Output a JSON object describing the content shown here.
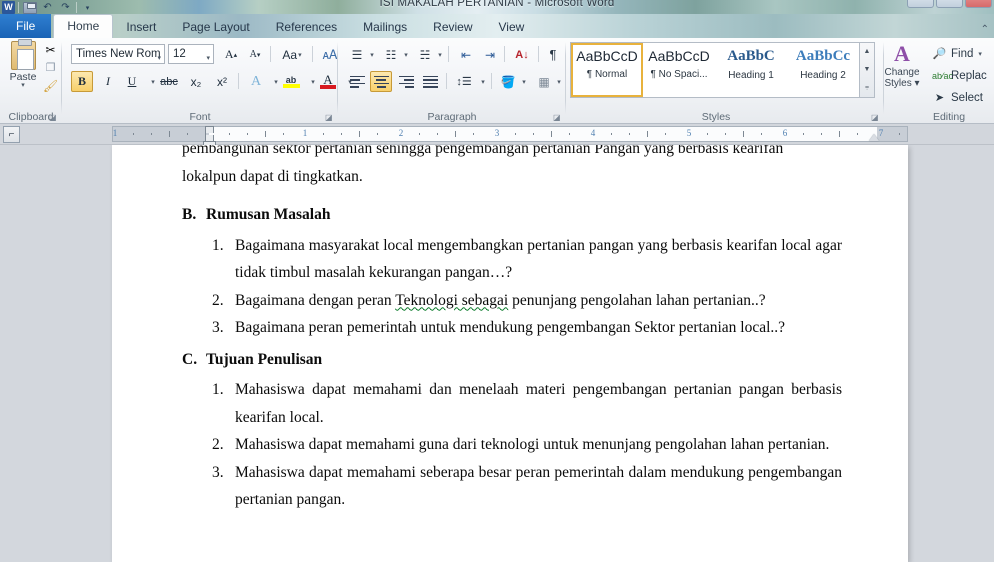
{
  "window": {
    "title": "ISI MAKALAH PERTANIAN - Microsoft Word",
    "app_icon": "word-icon",
    "quick_access": [
      "save-icon",
      "undo-icon",
      "redo-icon",
      "customize-qat-icon"
    ],
    "controls": [
      "minimize",
      "restore",
      "close"
    ],
    "ribbon_minimize_icon": "chevron-up-icon"
  },
  "tabs": [
    {
      "label": "File",
      "active": false,
      "type": "file"
    },
    {
      "label": "Home",
      "active": true
    },
    {
      "label": "Insert",
      "active": false
    },
    {
      "label": "Page Layout",
      "active": false
    },
    {
      "label": "References",
      "active": false
    },
    {
      "label": "Mailings",
      "active": false
    },
    {
      "label": "Review",
      "active": false
    },
    {
      "label": "View",
      "active": false
    }
  ],
  "ribbon": {
    "clipboard": {
      "label": "Clipboard",
      "paste_label": "Paste",
      "paste_icon": "clipboard-paste-icon",
      "paste_arrow": "▾",
      "cut_icon": "scissors-icon",
      "copy_icon": "copy-icon",
      "format_painter_icon": "paintbrush-icon",
      "launcher_icon": "dialog-launcher-icon"
    },
    "font": {
      "label": "Font",
      "font_name": "Times New Rom",
      "font_size": "12",
      "grow_font_icon": "grow-font-icon",
      "shrink_font_icon": "shrink-font-icon",
      "change_case_icon": "change-case-icon",
      "clear_formatting_icon": "clear-formatting-icon",
      "bold_label": "B",
      "italic_label": "I",
      "underline_label": "U",
      "strikethrough_label": "abc",
      "subscript_label": "x₂",
      "superscript_label": "x²",
      "text_effects_icon": "text-effects-icon",
      "highlight_icon": "text-highlight-icon",
      "font_color_icon": "font-color-icon",
      "launcher_icon": "dialog-launcher-icon",
      "bold_active": true
    },
    "paragraph": {
      "label": "Paragraph",
      "bullets_icon": "bullets-icon",
      "numbering_icon": "numbering-icon",
      "multilevel_icon": "multilevel-list-icon",
      "decrease_indent_icon": "decrease-indent-icon",
      "increase_indent_icon": "increase-indent-icon",
      "sort_icon": "sort-az-icon",
      "show_marks_icon": "pilcrow-icon",
      "align_left_icon": "align-left-icon",
      "align_center_icon": "align-center-icon",
      "align_right_icon": "align-right-icon",
      "justify_icon": "justify-icon",
      "line_spacing_icon": "line-spacing-icon",
      "shading_icon": "shading-icon",
      "borders_icon": "borders-icon",
      "launcher_icon": "dialog-launcher-icon",
      "align_center_active": true
    },
    "styles": {
      "label": "Styles",
      "gallery": [
        {
          "sample": "AaBbCcD",
          "name": "¶ Normal",
          "selected": true
        },
        {
          "sample": "AaBbCcD",
          "name": "¶ No Spaci...",
          "selected": false
        },
        {
          "sample": "AaBbC",
          "name": "Heading 1",
          "selected": false
        },
        {
          "sample": "AaBbCc",
          "name": "Heading 2",
          "selected": false
        }
      ],
      "scroll_up_icon": "scroll-up-icon",
      "scroll_down_icon": "scroll-down-icon",
      "more_icon": "more-styles-icon",
      "change_styles_label": "Change\nStyles",
      "change_styles_line1": "Change",
      "change_styles_line2": "Styles ▾",
      "change_styles_icon": "change-styles-icon",
      "launcher_icon": "dialog-launcher-icon"
    },
    "editing": {
      "label": "Editing",
      "find_label": "Find",
      "find_icon": "binoculars-icon",
      "find_chevron": "▾",
      "replace_label": "Replac",
      "replace_icon": "replace-icon",
      "select_label": "Select",
      "select_icon": "cursor-arrow-icon"
    }
  },
  "ruler": {
    "tab_selector_icon": "tab-left-icon",
    "numbers": [
      "1",
      "1",
      "2",
      "3",
      "4",
      "5",
      "6",
      "7"
    ],
    "left_indent_icon": "left-indent-marker",
    "right_indent_icon": "right-indent-marker"
  },
  "document": {
    "paragraphs": [
      {
        "type": "text",
        "clipped_top": true,
        "text": "pembangunan sektor pertanian sehingga pengembangan pertanian Pangan yang berbasis kearifan"
      },
      {
        "type": "text",
        "text": "lokalpun dapat di tingkatkan."
      }
    ],
    "sections": [
      {
        "label": "B.",
        "heading": "Rumusan Masalah",
        "items": [
          {
            "n": "1.",
            "text": "Bagaimana masyarakat local mengembangkan pertanian pangan yang berbasis kearifan local agar tidak timbul masalah kekurangan pangan…?",
            "justify": true
          },
          {
            "n": "2.",
            "text_before": "Bagaimana dengan peran ",
            "text_squiggle": "Teknologi  sebagai",
            "text_after": " penunjang pengolahan lahan pertanian..?",
            "justify": false
          },
          {
            "n": "3.",
            "text": "Bagaimana peran pemerintah untuk mendukung pengembangan Sektor pertanian local..?",
            "justify": false
          }
        ]
      },
      {
        "label": "C.",
        "heading": "Tujuan Penulisan",
        "items": [
          {
            "n": "1.",
            "text": "Mahasiswa dapat memahami dan menelaah materi pengembangan pertanian pangan berbasis kearifan local.",
            "justify": true
          },
          {
            "n": "2.",
            "text": "Mahasiswa dapat memahami guna dari teknologi untuk menunjang pengolahan lahan pertanian.",
            "justify": true
          },
          {
            "n": "3.",
            "text": "Mahasiswa dapat memahami seberapa besar peran pemerintah dalam mendukung pengembangan pertanian pangan.",
            "justify": true
          }
        ]
      }
    ]
  },
  "colors": {
    "file_tab": "#1a63b6",
    "accent_gold": "#f7cf6a",
    "heading1": "#2a5a8c",
    "heading2": "#3d7dbb",
    "squiggle_green": "#0a7a2a",
    "chrome": "#d3d7dd"
  }
}
